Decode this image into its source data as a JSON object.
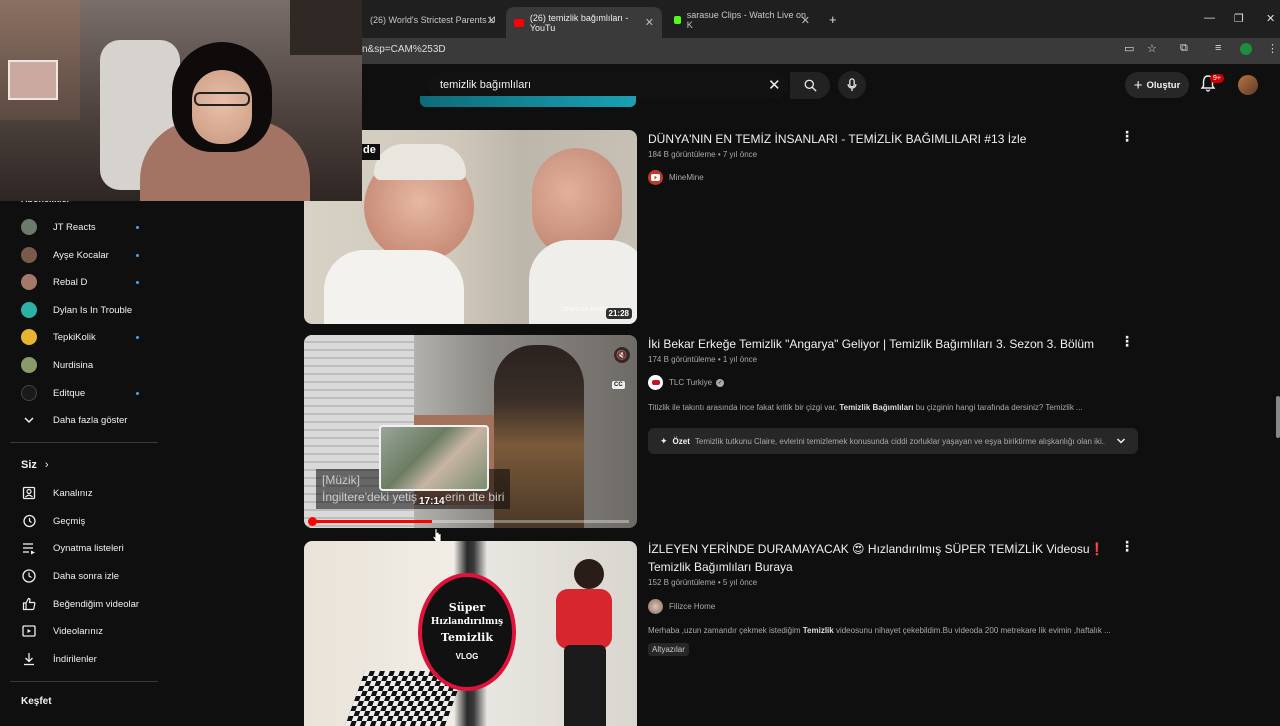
{
  "browser": {
    "tabs": [
      {
        "label": "(26) World's Strictest Parents U"
      },
      {
        "label": "(26) temizlik bağımlıları - YouTu"
      },
      {
        "label": "sarasue Clips - Watch Live on K"
      }
    ],
    "new_tab": "+",
    "url": "n&sp=CAM%253D",
    "colors": {
      "yt_red": "#ff0000",
      "kick_green": "#53fc18"
    }
  },
  "header": {
    "search_value": "temizlik bağımlıları",
    "create_label": "Oluştur",
    "notif_count": "9+"
  },
  "webcam_overlay": {
    "label": "de"
  },
  "sidebar": {
    "section_partial": "Abonelikler",
    "subs": [
      {
        "name": "JT Reacts",
        "color": "#6b7a6b"
      },
      {
        "name": "Ayşe Kocalar",
        "color": "#7a5a4a"
      },
      {
        "name": "Rebal D",
        "color": "#a5796a"
      },
      {
        "name": "Dylan Is In Trouble",
        "color": "#2bb3a8"
      },
      {
        "name": "TepkiKolik",
        "color": "#e8b531"
      },
      {
        "name": "Nurdisina",
        "color": "#8a9a6a"
      },
      {
        "name": "Editque",
        "color": "#1a1a1a"
      }
    ],
    "show_more": "Daha fazla göster",
    "you_section": "Siz",
    "you_items": [
      {
        "label": "Kanalınız",
        "icon": "channel-icon"
      },
      {
        "label": "Geçmiş",
        "icon": "history-icon"
      },
      {
        "label": "Oynatma listeleri",
        "icon": "playlists-icon"
      },
      {
        "label": "Daha sonra izle",
        "icon": "watch-later-icon"
      },
      {
        "label": "Beğendiğim videolar",
        "icon": "like-icon"
      },
      {
        "label": "Videolarınız",
        "icon": "your-videos-icon"
      },
      {
        "label": "İndirilenler",
        "icon": "download-icon"
      }
    ],
    "explore": "Keşfet"
  },
  "results": [
    {
      "title": "DÜNYA'NIN EN TEMİZ İNSANLARI - TEMİZLİK BAĞIMLILARI #13 İzle",
      "meta": "184 B görüntüleme • 7 yıl önce",
      "channel": "MineMine",
      "duration": "21:28",
      "thumb_watermark": "TEMİZLİK HASTA"
    },
    {
      "title": "İki Bekar Erkeğe Temizlik \"Angarya\" Geliyor | Temizlik Bağımlıları 3. Sezon 3. Bölüm",
      "meta": "174 B görüntüleme • 1 yıl önce",
      "channel": "TLC Turkiye",
      "desc_pre": "Titizlik ile takıntı arasında ince fakat kritik bir çizgi var, ",
      "desc_bold": "Temizlik Bağımlıları",
      "desc_post": " bu çizginin hangi tarafında dersiniz? Temizlik ...",
      "summary_label": "Özet",
      "summary_text": "Temizlik tutkunu Claire, evlerini temizlemek konusunda ciddi zorluklar yaşayan ve eşya biriktirme alışkanlığı olan iki...",
      "preview_caption_1": "[Müzik]",
      "preview_caption_2": "İngiltere'deki yetiş",
      "preview_caption_3": "erin dte biri",
      "preview_time": "17:14",
      "cc_label": "CC",
      "progress": 0.38
    },
    {
      "title_a": "İZLEYEN YERİNDE DURAMAYACAK ",
      "title_emoji": "😍",
      "title_b": " Hızlandırılmış SÜPER TEMİZLİK Videosu",
      "title_mark": "❗",
      "title_line2": "Temizlik Bağımlıları Buraya",
      "meta": "152 B görüntüleme • 5 yıl önce",
      "channel": "Filizce Home",
      "desc_pre": "Merhaba ,uzun zamandır çekmek istediğim ",
      "desc_bold": "Temizlik",
      "desc_post": " videosunu nihayet çekebildim.Bu videoda 200 metrekare lik evimin ,haftalık ...",
      "badge": "Altyazılar",
      "thumb_text": [
        "Süper",
        "Hızlandırılmış",
        "Temizlik",
        "VLOG"
      ]
    }
  ]
}
